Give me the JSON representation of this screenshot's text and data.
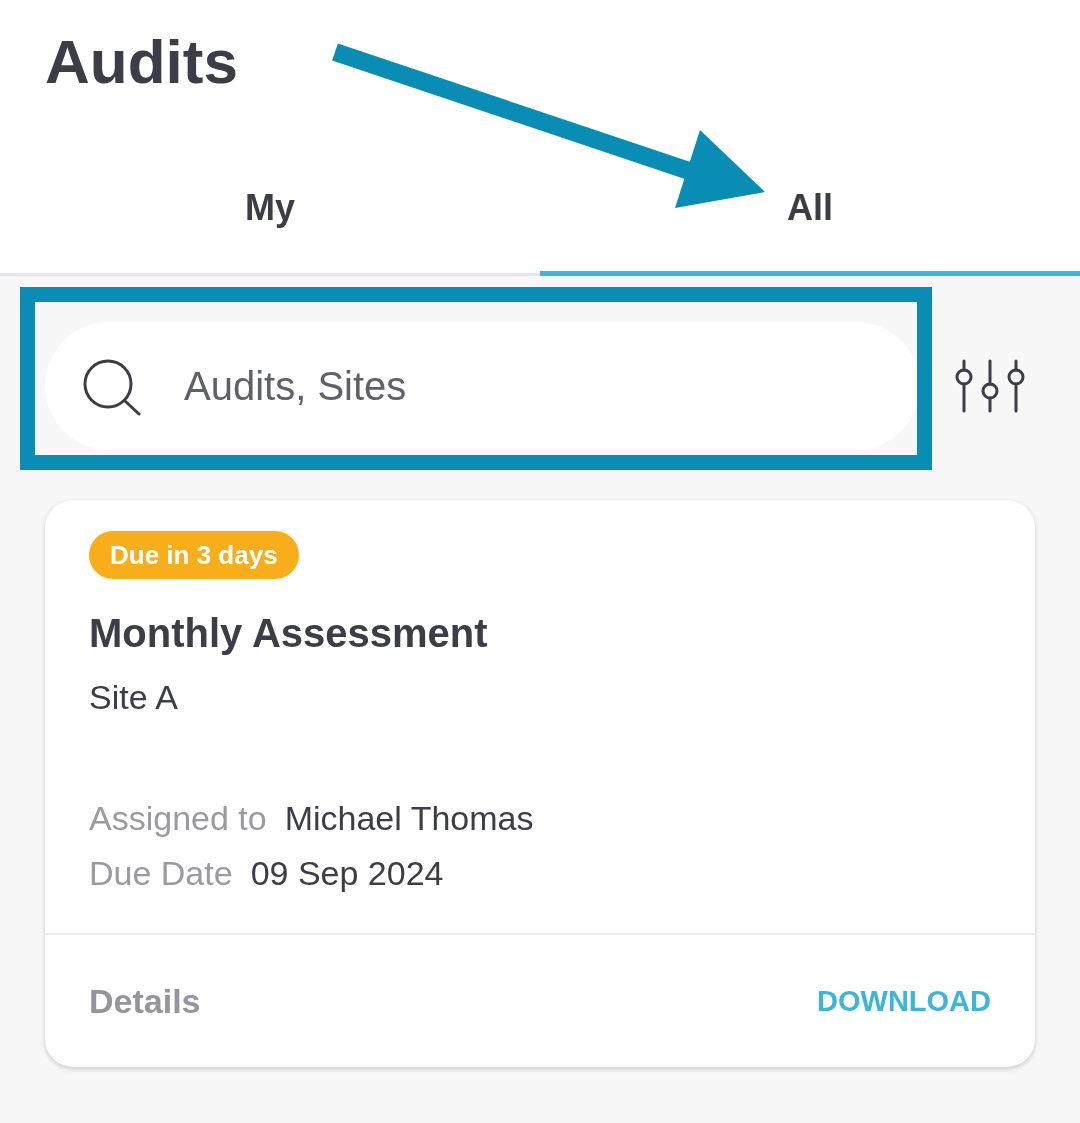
{
  "header": {
    "title": "Audits"
  },
  "tabs": [
    {
      "label": "My",
      "selected": false,
      "annotated": false
    },
    {
      "label": "All",
      "selected": true,
      "annotated": true
    }
  ],
  "search": {
    "placeholder": "Audits, Sites",
    "highlighted": true
  },
  "audits": [
    {
      "badge": "Due in 3 days",
      "title": "Monthly Assessment",
      "site": "Site A",
      "fields": [
        {
          "label": "Assigned to",
          "value": "Michael Thomas"
        },
        {
          "label": "Due Date",
          "value": "09 Sep 2024"
        }
      ],
      "actions": [
        {
          "label": "Details",
          "kind": "secondary"
        },
        {
          "label": "DOWNLOAD",
          "kind": "primary"
        }
      ]
    }
  ]
}
